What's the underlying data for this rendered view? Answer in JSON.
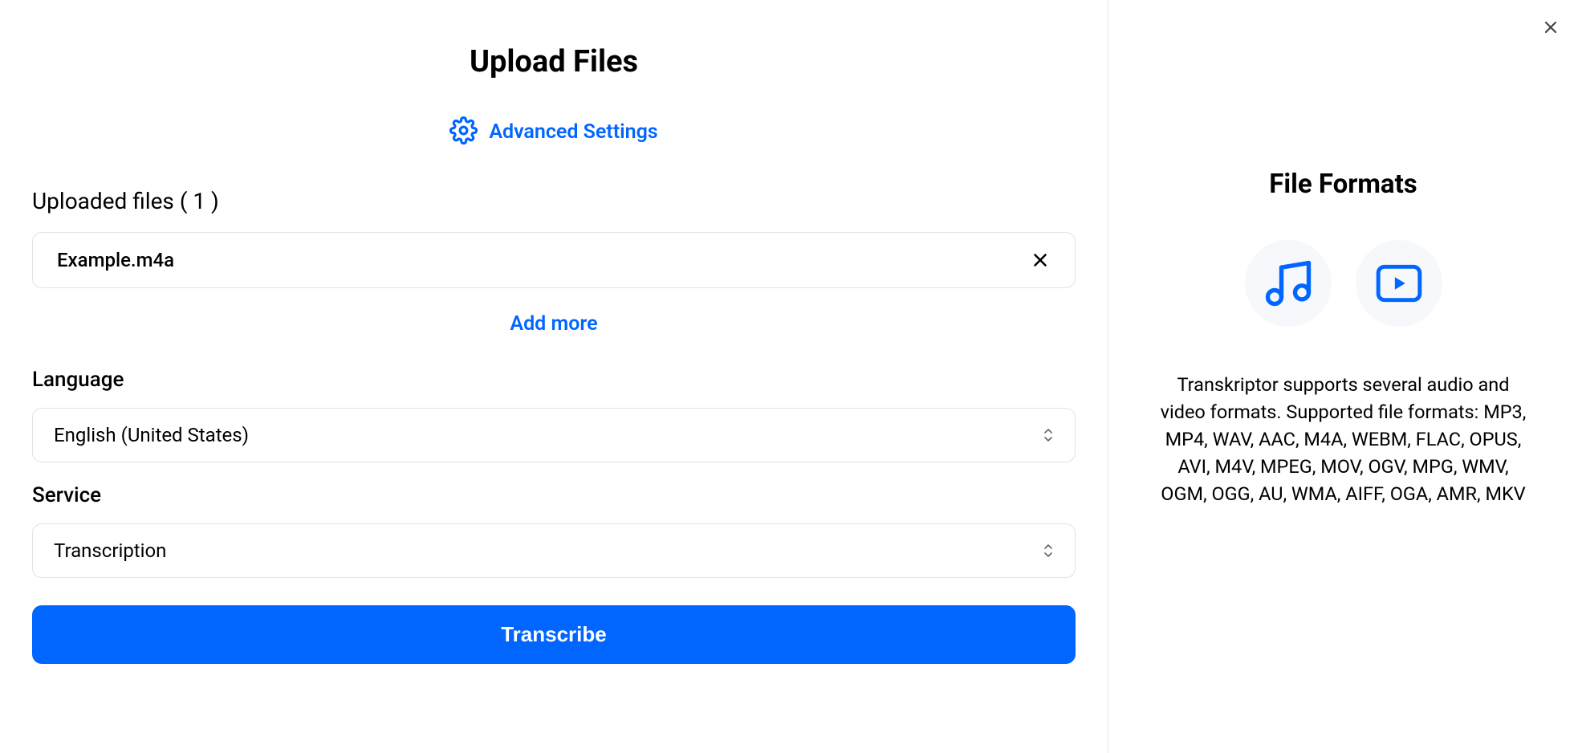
{
  "page": {
    "title": "Upload Files"
  },
  "advancedSettings": {
    "label": "Advanced Settings"
  },
  "uploadedFiles": {
    "heading": "Uploaded files ( 1 )",
    "items": [
      {
        "name": "Example.m4a"
      }
    ]
  },
  "addMore": {
    "label": "Add more"
  },
  "language": {
    "label": "Language",
    "selected": "English (United States)"
  },
  "service": {
    "label": "Service",
    "selected": "Transcription"
  },
  "transcribe": {
    "label": "Transcribe"
  },
  "sidebar": {
    "title": "File Formats",
    "description": "Transkriptor supports several audio and video formats. Supported file formats: MP3, MP4, WAV, AAC, M4A, WEBM, FLAC, OPUS, AVI, M4V, MPEG, MOV, OGV, MPG, WMV, OGM, OGG, AU, WMA, AIFF, OGA, AMR, MKV"
  },
  "colors": {
    "accent": "#0066FF"
  }
}
